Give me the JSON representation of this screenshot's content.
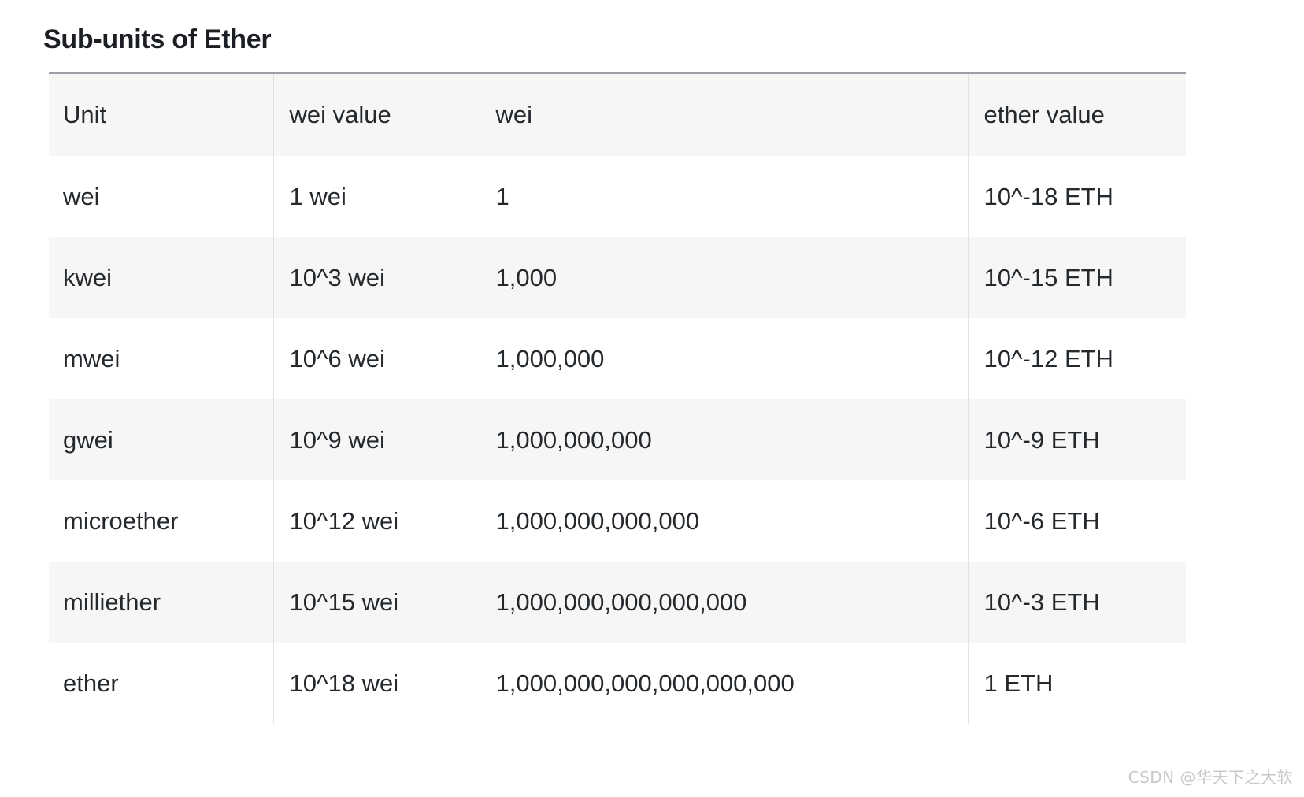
{
  "page": {
    "title": "Sub-units of Ether",
    "watermark": "CSDN @华天下之大软",
    "background_color": "#ffffff",
    "stripe_color": "#f6f6f6",
    "border_color": "#9aa0a6",
    "text_color": "#24292e"
  },
  "table": {
    "columns": [
      {
        "key": "unit",
        "label": "Unit"
      },
      {
        "key": "wei_value",
        "label": "wei value"
      },
      {
        "key": "wei",
        "label": "wei"
      },
      {
        "key": "ether_value",
        "label": "ether value"
      }
    ],
    "rows": [
      {
        "unit": "wei",
        "wei_value": "1 wei",
        "wei": "1",
        "ether_value": "10^-18 ETH"
      },
      {
        "unit": "kwei",
        "wei_value": "10^3 wei",
        "wei": "1,000",
        "ether_value": "10^-15 ETH"
      },
      {
        "unit": "mwei",
        "wei_value": "10^6 wei",
        "wei": "1,000,000",
        "ether_value": "10^-12 ETH"
      },
      {
        "unit": "gwei",
        "wei_value": "10^9 wei",
        "wei": "1,000,000,000",
        "ether_value": "10^-9 ETH"
      },
      {
        "unit": "microether",
        "wei_value": "10^12 wei",
        "wei": "1,000,000,000,000",
        "ether_value": "10^-6 ETH"
      },
      {
        "unit": "milliether",
        "wei_value": "10^15 wei",
        "wei": "1,000,000,000,000,000",
        "ether_value": "10^-3 ETH"
      },
      {
        "unit": "ether",
        "wei_value": "10^18 wei",
        "wei": "1,000,000,000,000,000,000",
        "ether_value": "1 ETH"
      }
    ]
  }
}
